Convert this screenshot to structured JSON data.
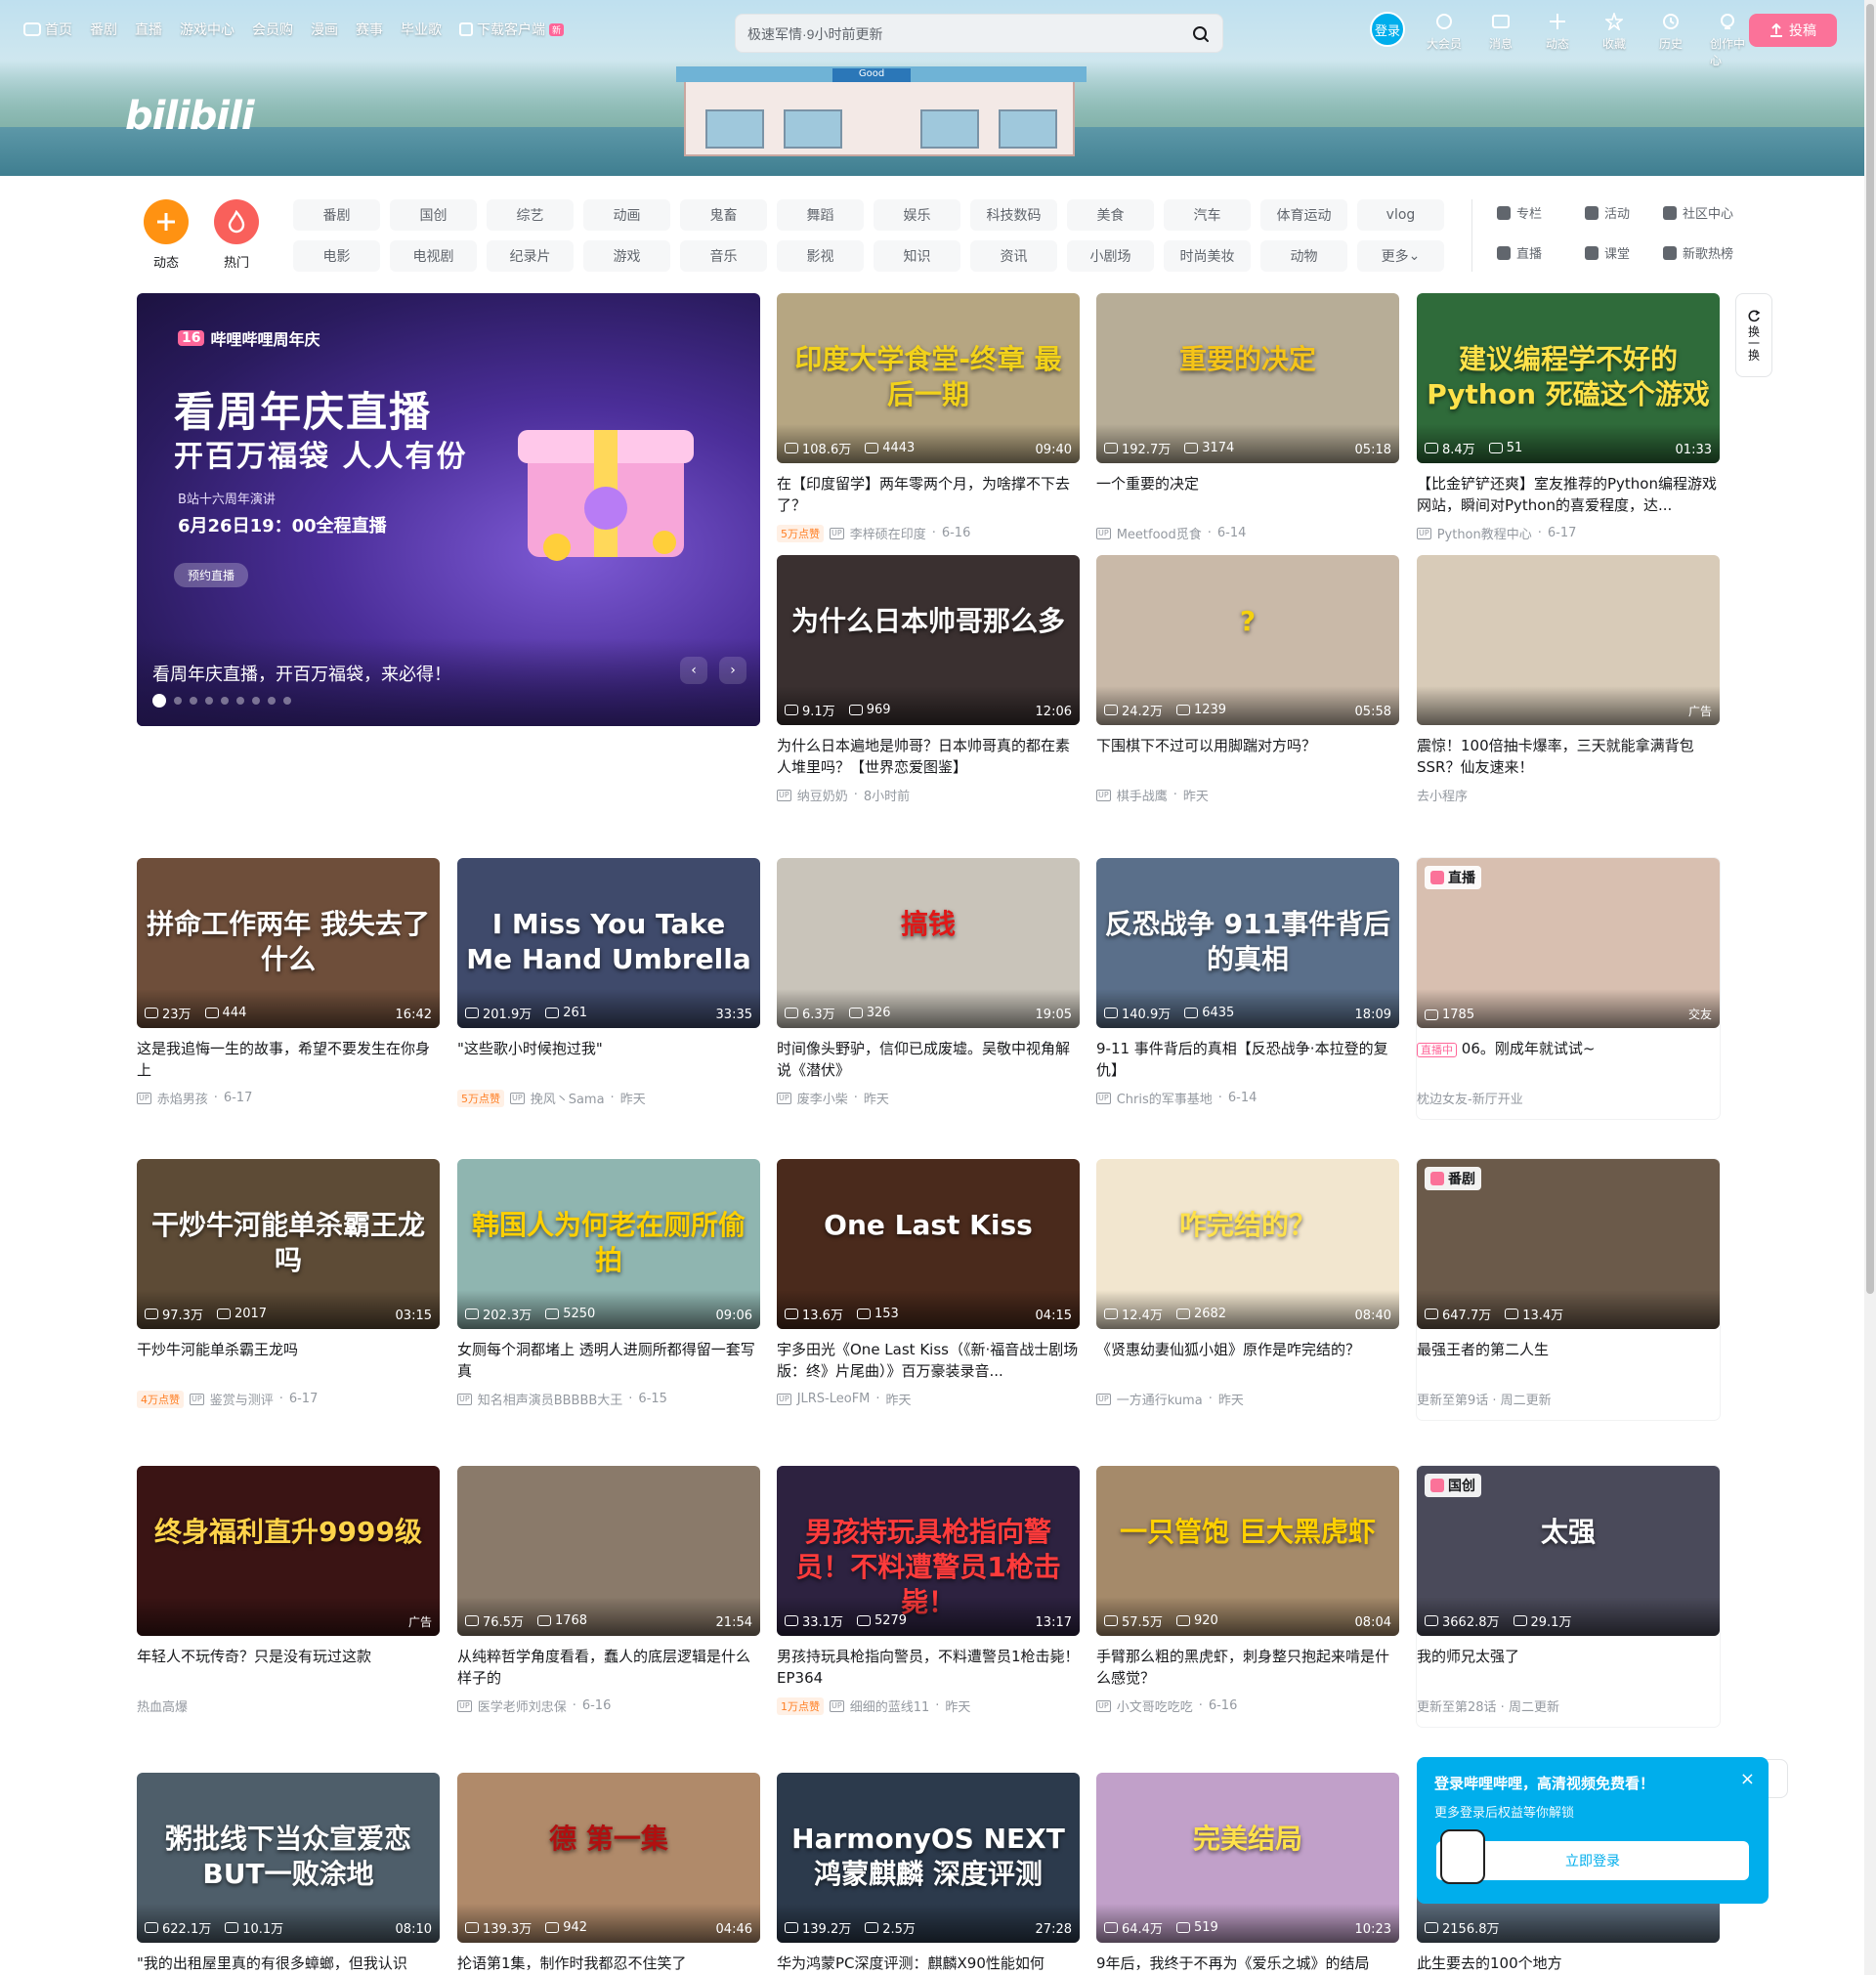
{
  "topnav": {
    "items": [
      "首页",
      "番剧",
      "直播",
      "游戏中心",
      "会员购",
      "漫画",
      "赛事",
      "毕业歌",
      "下载客户端"
    ],
    "new_badge": "新"
  },
  "search": {
    "placeholder": "极速军情·9小时前更新"
  },
  "rightnav": {
    "login": "登录",
    "items": [
      "大会员",
      "消息",
      "动态",
      "收藏",
      "历史",
      "创作中心"
    ],
    "upload": "投稿"
  },
  "banner": {
    "logo": "bilibili",
    "store_sign": "Good"
  },
  "channels": {
    "round": [
      {
        "label": "动态",
        "color": "#ff9212"
      },
      {
        "label": "热门",
        "color": "#f9605b"
      }
    ],
    "pills": [
      "番剧",
      "国创",
      "综艺",
      "动画",
      "鬼畜",
      "舞蹈",
      "娱乐",
      "科技数码",
      "美食",
      "汽车",
      "体育运动",
      "vlog",
      "电影",
      "电视剧",
      "纪录片",
      "游戏",
      "音乐",
      "影视",
      "知识",
      "资讯",
      "小剧场",
      "时尚美妆",
      "动物",
      "更多"
    ],
    "links": [
      "专栏",
      "活动",
      "社区中心",
      "直播",
      "课堂",
      "新歌热榜"
    ]
  },
  "carousel": {
    "brand": "哔哩哔哩周年庆",
    "badge": "16",
    "headline1": "看周年庆直播",
    "headline2": "开百万福袋  人人有份",
    "sub1": "B站十六周年演讲",
    "sub2": "6月26日19：00全程直播",
    "reserve": "预约直播",
    "caption": "看周年庆直播，开百万福袋，来必得！",
    "dots": 9,
    "prev": "‹",
    "next": "›"
  },
  "refresh": {
    "label": "换一换"
  },
  "cards": [
    {
      "thumb_text": "印度大学食堂-终章 最后一期",
      "views": "108.6万",
      "danmaku": "4443",
      "duration": "09:40",
      "title": "在【印度留学】两年零两个月，为啥撑不下去了？",
      "likes": "5万点赞",
      "author": "李梓硕在印度",
      "date": "6-16",
      "bg": "#b6a682",
      "fg": "#f2d21a"
    },
    {
      "thumb_text": "重要的决定",
      "views": "192.7万",
      "danmaku": "3174",
      "duration": "05:18",
      "title": "一个重要的决定",
      "likes": "",
      "author": "Meetfood觅食",
      "date": "6-14",
      "bg": "#b7ad97",
      "fg": "#f5c418"
    },
    {
      "thumb_text": "建议编程学不好的 Python 死磕这个游戏",
      "views": "8.4万",
      "danmaku": "51",
      "duration": "01:33",
      "title": "【比金铲铲还爽】室友推荐的Python编程游戏网站，瞬间对Python的喜爱程度，达...",
      "likes": "",
      "author": "Python教程中心",
      "date": "6-17",
      "bg": "#2f6b3a",
      "fg": "#ffe24a"
    },
    {
      "thumb_text": "为什么日本帅哥那么多",
      "views": "9.1万",
      "danmaku": "969",
      "duration": "12:06",
      "title": "为什么日本遍地是帅哥？日本帅哥真的都在素人堆里吗？【世界恋爱图鉴】",
      "likes": "",
      "author": "纳豆奶奶",
      "date": "8小时前",
      "bg": "#3a3030",
      "fg": "#ffffff"
    },
    {
      "thumb_text": "?",
      "views": "24.2万",
      "danmaku": "1239",
      "duration": "05:58",
      "title": "下围棋下不过可以用脚踹对方吗？",
      "likes": "",
      "author": "棋手战鹰",
      "date": "昨天",
      "bg": "#c9b9a8",
      "fg": "#f5d10f"
    },
    {
      "thumb_text": "",
      "views": "",
      "danmaku": "",
      "duration": "",
      "ad": "广告",
      "title": "震惊！100倍抽卡爆率，三天就能拿满背包SSR？仙友速来！",
      "likes": "",
      "author": "去小程序",
      "date": "",
      "bg": "#d8cbb8",
      "fg": "#ffffff"
    },
    {
      "thumb_text": "拼命工作两年 我失去了什么",
      "views": "23万",
      "danmaku": "444",
      "duration": "16:42",
      "title": "这是我追悔一生的故事，希望不要发生在你身上",
      "likes": "",
      "author": "赤焰男孩",
      "date": "6-17",
      "bg": "#6e4e3a",
      "fg": "#ffffff"
    },
    {
      "thumb_text": "I Miss You  Take Me Hand  Umbrella",
      "views": "201.9万",
      "danmaku": "261",
      "duration": "33:35",
      "title": "\"这些歌小时候抱过我\"",
      "likes": "5万点赞",
      "author": "挽风丶Sama",
      "date": "昨天",
      "bg": "#3f4a6b",
      "fg": "#ffffff"
    },
    {
      "thumb_text": "搞钱",
      "views": "6.3万",
      "danmaku": "326",
      "duration": "19:05",
      "title": "时间像头野驴，信仰已成废墟。吴敬中视角解说《潜伏》",
      "likes": "",
      "author": "废李小柴",
      "date": "昨天",
      "bg": "#c9c4ba",
      "fg": "#e01818"
    },
    {
      "thumb_text": "反恐战争 911事件背后的真相",
      "views": "140.9万",
      "danmaku": "6435",
      "duration": "18:09",
      "title": "9-11 事件背后的真相【反恐战争·本拉登的复仇】",
      "likes": "",
      "author": "Chris的军事基地",
      "date": "6-14",
      "bg": "#5a6f8a",
      "fg": "#ffffff"
    },
    {
      "thumb_text": "",
      "views": "1785",
      "danmaku": "",
      "duration": "",
      "live_corner": "交友",
      "corner": "直播",
      "title": "06。刚成年就试试~",
      "live_badge": "直播中",
      "likes": "",
      "author": "枕边女友-新厅开业",
      "date": "",
      "bg": "#d8bfb0",
      "fg": "#ffffff"
    },
    {
      "thumb_text": "干炒牛河能单杀霸王龙吗",
      "views": "97.3万",
      "danmaku": "2017",
      "duration": "03:15",
      "title": "干炒牛河能单杀霸王龙吗",
      "likes": "4万点赞",
      "author": "鉴赏与测评",
      "date": "6-17",
      "bg": "#5d4b36",
      "fg": "#ffffff"
    },
    {
      "thumb_text": "韩国人为何老在厕所偷拍",
      "views": "202.3万",
      "danmaku": "5250",
      "duration": "09:06",
      "title": "女厕每个洞都堵上 透明人进厕所都得留一套写真",
      "likes": "",
      "author": "知名相声演员BBBBB大王",
      "date": "6-15",
      "bg": "#8fb5b0",
      "fg": "#ffd000"
    },
    {
      "thumb_text": "One Last Kiss",
      "views": "13.6万",
      "danmaku": "153",
      "duration": "04:15",
      "title": "宇多田光《One Last Kiss（《新·福音战士剧场版：终》片尾曲）》百万豪装录音...",
      "likes": "",
      "author": "JLRS-LeoFM",
      "date": "昨天",
      "bg": "#4a2a1c",
      "fg": "#ffffff"
    },
    {
      "thumb_text": "咋完结的？",
      "views": "12.4万",
      "danmaku": "2682",
      "duration": "08:40",
      "title": "《贤惠幼妻仙狐小姐》原作是咋完结的？",
      "likes": "",
      "author": "一方通行kuma",
      "date": "昨天",
      "bg": "#f2e6cf",
      "fg": "#ffe14a"
    },
    {
      "thumb_text": "",
      "views": "647.7万",
      "danmaku": "13.4万",
      "duration": "",
      "corner": "番剧",
      "title": "最强王者的第二人生",
      "likes": "",
      "author": "更新至第9话 · 周二更新",
      "date": "",
      "bg": "#6b5a4a",
      "fg": "#ffffff"
    },
    {
      "thumb_text": "终身福利直升9999级",
      "views": "",
      "danmaku": "",
      "duration": "",
      "ad": "广告",
      "title": "年轻人不玩传奇？只是没有玩过这款",
      "likes": "",
      "author": "热血高爆",
      "date": "",
      "bg": "#3a1414",
      "fg": "#ffd34a"
    },
    {
      "thumb_text": "",
      "views": "76.5万",
      "danmaku": "1768",
      "duration": "21:54",
      "title": "从纯粹哲学角度看看，蠢人的底层逻辑是什么样子的",
      "likes": "",
      "author": "医学老师刘忠保",
      "date": "6-16",
      "bg": "#8a7a6a",
      "fg": "#ffffff"
    },
    {
      "thumb_text": "男孩持玩具枪指向警员！不料遭警员1枪击毙！",
      "views": "33.1万",
      "danmaku": "5279",
      "duration": "13:17",
      "title": "男孩持玩具枪指向警员，不料遭警员1枪击毙！EP364",
      "likes": "1万点赞",
      "author": "细细的蓝线11",
      "date": "昨天",
      "bg": "#2d2240",
      "fg": "#ff3b3b"
    },
    {
      "thumb_text": "一只管饱 巨大黑虎虾",
      "views": "57.5万",
      "danmaku": "920",
      "duration": "08:04",
      "title": "手臂那么粗的黑虎虾，刺身整只抱起来啃是什么感觉？",
      "likes": "",
      "author": "小文哥吃吃吃",
      "date": "6-16",
      "bg": "#a58a6a",
      "fg": "#ffd000"
    },
    {
      "thumb_text": "太强",
      "views": "3662.8万",
      "danmaku": "29.1万",
      "duration": "",
      "corner": "国创",
      "title": "我的师兄太强了",
      "likes": "",
      "author": "更新至第28话 · 周二更新",
      "date": "",
      "bg": "#4a4a5a",
      "fg": "#ffffff"
    },
    {
      "thumb_text": "粥批线下当众宣爱恋 BUT一败涂地",
      "views": "622.1万",
      "danmaku": "10.1万",
      "duration": "08:10",
      "title": "\"我的出租屋里真的有很多蟑螂，但我认识",
      "likes": "",
      "author": "",
      "date": "",
      "bg": "#4e5e6a",
      "fg": "#ffffff"
    },
    {
      "thumb_text": "德 第一集",
      "views": "139.3万",
      "danmaku": "942",
      "duration": "04:46",
      "title": "抡语第1集，制作时我都忍不住笑了",
      "likes": "",
      "author": "",
      "date": "",
      "bg": "#b08a6a",
      "fg": "#b01010"
    },
    {
      "thumb_text": "HarmonyOS NEXT 鸿蒙麒麟 深度评测",
      "views": "139.2万",
      "danmaku": "2.5万",
      "duration": "27:28",
      "title": "华为鸿蒙PC深度评测：麒麟X90性能如何",
      "likes": "",
      "author": "",
      "date": "",
      "bg": "#2c3a4c",
      "fg": "#ffffff"
    },
    {
      "thumb_text": "完美结局",
      "views": "64.4万",
      "danmaku": "519",
      "duration": "10:23",
      "title": "9年后，我终于不再为《爱乐之城》的结局",
      "likes": "",
      "author": "",
      "date": "",
      "bg": "#c1a0c9",
      "fg": "#ffe14a"
    },
    {
      "thumb_text": "",
      "views": "2156.8万",
      "danmaku": "",
      "duration": "",
      "title": "此生要去的100个地方",
      "likes": "",
      "author": "",
      "date": "",
      "bg": "#5a6a7a",
      "fg": "#ffffff"
    }
  ],
  "popup": {
    "title": "登录哔哩哔哩，高清视频免费看！",
    "subtitle": "更多登录后权益等你解锁",
    "button": "立即登录",
    "close": "×"
  }
}
